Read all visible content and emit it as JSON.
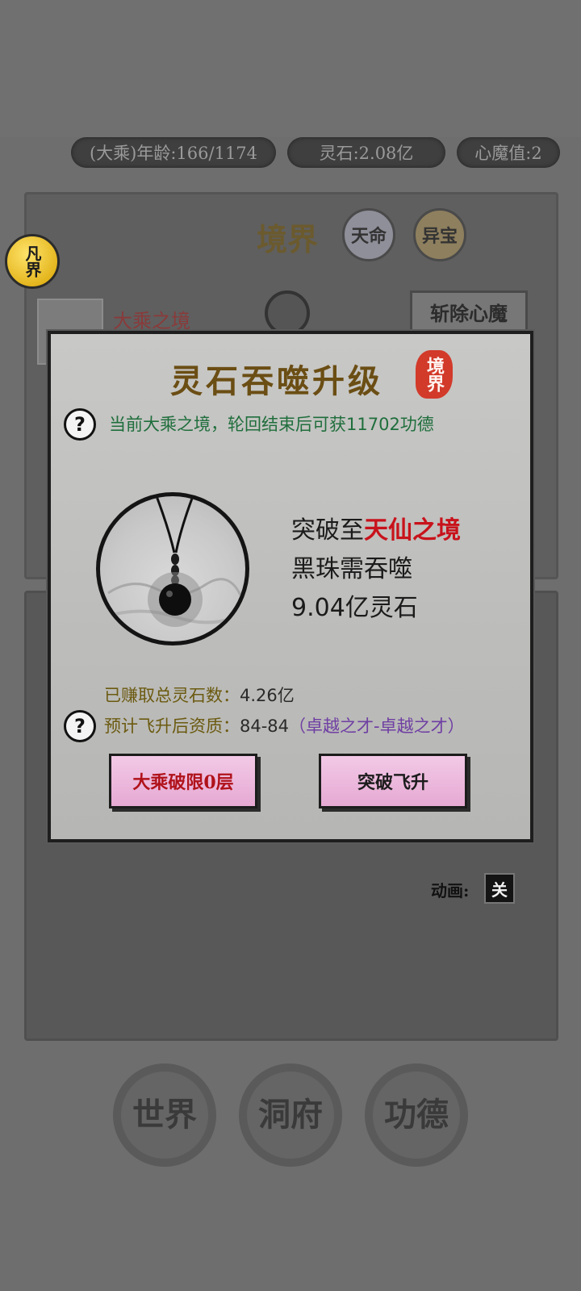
{
  "status_bar": {
    "age": "(大乘)年龄:166/1174",
    "spirit_stone": "灵石:2.08亿",
    "heart_demon": "心魔值:2"
  },
  "background": {
    "realm_title": "境界",
    "btn_fate": "天命",
    "btn_treasure": "异宝",
    "fanjie_badge": "凡界",
    "current_realm": "大乘之境",
    "kill_demon": "斩除心魔",
    "animation_label": "动画:",
    "animation_toggle": "关"
  },
  "nav": {
    "world": "世界",
    "cave": "洞府",
    "merit": "功德"
  },
  "modal": {
    "title": "灵石吞噬升级",
    "seal_text": "境界",
    "reward_text": "当前大乘之境，轮回结束后可获11702功德",
    "breakthrough_prefix": "突破至",
    "breakthrough_target": "天仙之境",
    "devour_line": "黑珠需吞噬",
    "cost_line": "9.04亿灵石",
    "earned_label": "已赚取总灵石数：",
    "earned_value": "4.26亿",
    "aptitude_label": "预计飞升后资质：",
    "aptitude_value": "84-84",
    "aptitude_grade": "（卓越之才-卓越之才）",
    "btn_limit": "大乘破限0层",
    "btn_ascend": "突破飞升"
  },
  "colors": {
    "accent_red": "#c8121b",
    "reward_green": "#1f6e3c",
    "title_gold": "#6b4e14",
    "button_pink": "#e6a9d3",
    "grade_purple": "#6f3fa3"
  },
  "icons": {
    "help": "question-circle-icon",
    "pendant": "black-bead-pendant-image"
  }
}
